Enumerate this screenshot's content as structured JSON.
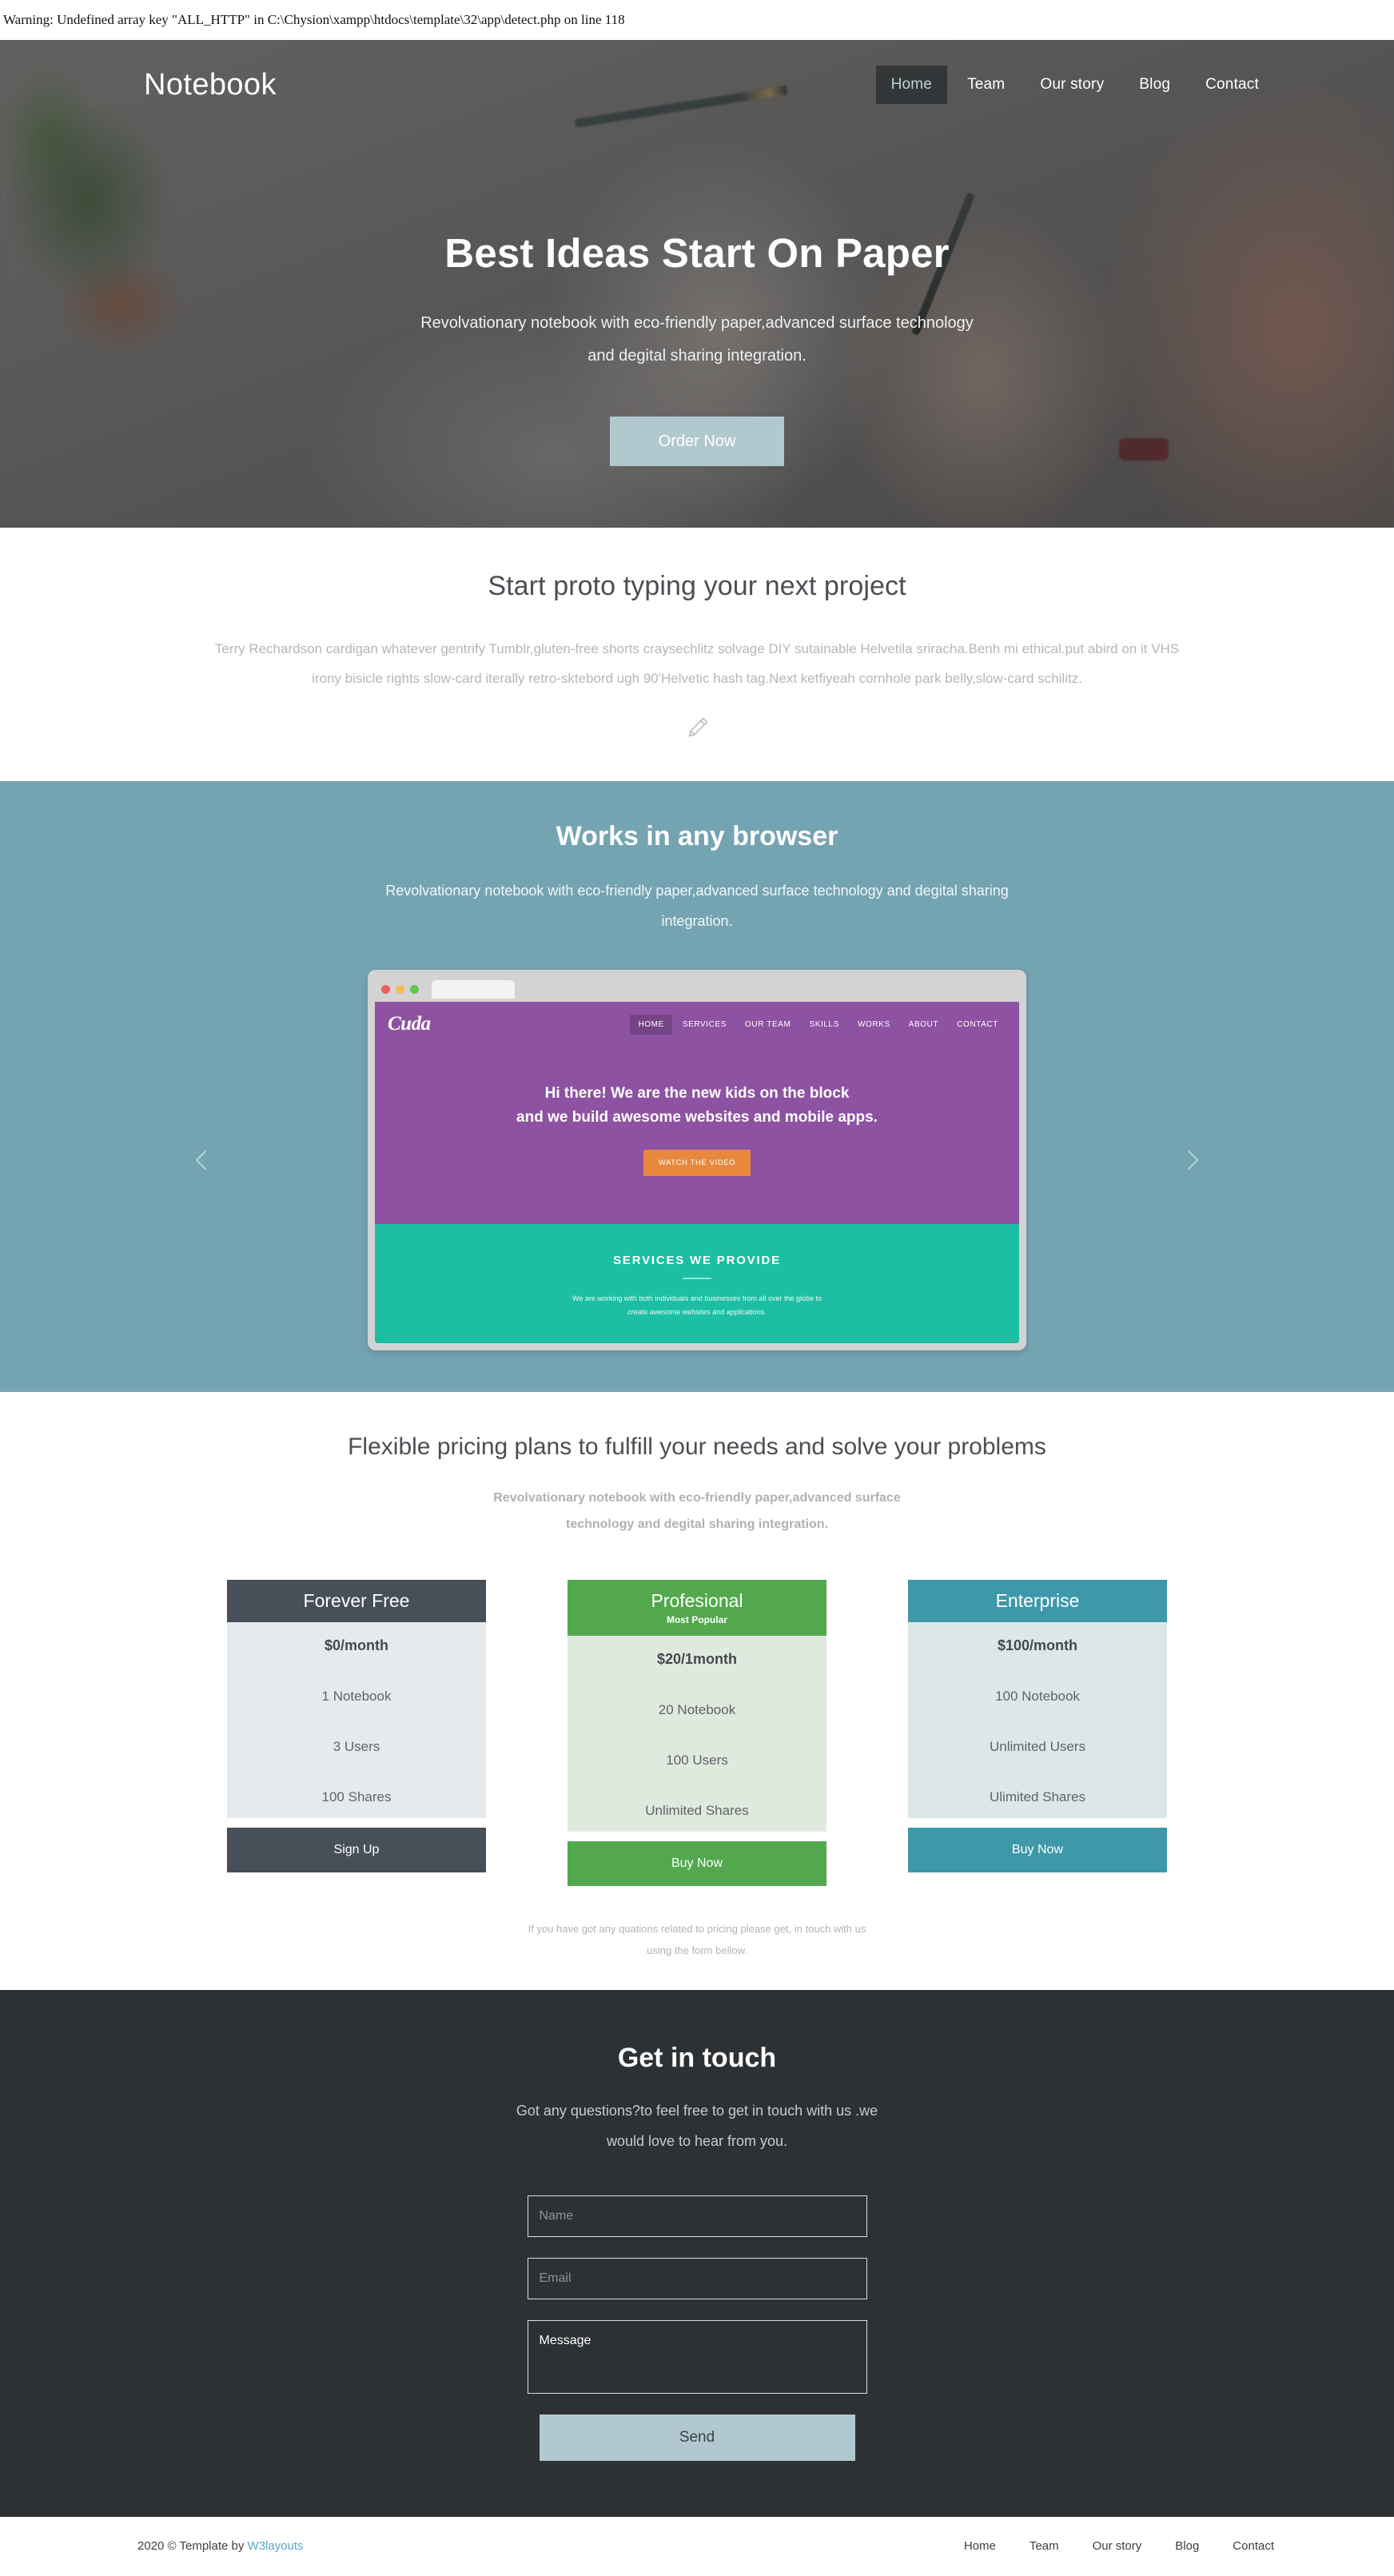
{
  "php_warning": "Warning: Undefined array key \"ALL_HTTP\" in C:\\Chysion\\xampp\\htdocs\\template\\32\\app\\detect.php on line 118",
  "header": {
    "brand": "Notebook",
    "nav": [
      {
        "label": "Home",
        "active": true
      },
      {
        "label": "Team",
        "active": false
      },
      {
        "label": "Our story",
        "active": false
      },
      {
        "label": "Blog",
        "active": false
      },
      {
        "label": "Contact",
        "active": false
      }
    ]
  },
  "hero": {
    "title": "Best Ideas Start On Paper",
    "subtitle": "Revolvationary notebook with eco-friendly paper,advanced surface technology and degital sharing integration.",
    "cta": "Order Now"
  },
  "proto": {
    "heading": "Start proto typing your next project",
    "paragraph": "Terry Rechardson cardigan whatever gentrify Tumblr,gluten-free shorts craysechlitz solvage DIY sutainable Helvetila sriracha.Benh mi ethical.put abird on it VHS irony bisicle rights slow-card iterally retro-sktebord ugh 90'Helvetic hash tag.Next ketfiyeah cornhole park belly,slow-card schilitz.",
    "icon": "pencil-icon"
  },
  "browser_section": {
    "heading": "Works in any browser",
    "subtitle": "Revolvationary notebook with eco-friendly paper,advanced surface technology and degital sharing integration.",
    "prev_icon": "chevron-left-icon",
    "next_icon": "chevron-right-icon",
    "mockup": {
      "logo": "Cuda",
      "nav": [
        {
          "label": "HOME",
          "active": true
        },
        {
          "label": "SERVICES",
          "active": false
        },
        {
          "label": "OUR TEAM",
          "active": false
        },
        {
          "label": "SKILLS",
          "active": false
        },
        {
          "label": "WORKS",
          "active": false
        },
        {
          "label": "ABOUT",
          "active": false
        },
        {
          "label": "CONTACT",
          "active": false
        }
      ],
      "headline_line1": "Hi there! We are the new kids on the block",
      "headline_line2": "and we build awesome websites and mobile apps.",
      "cta": "WATCH THE VIDEO",
      "services_title": "SERVICES WE PROVIDE",
      "services_line1": "We are working with both individuals and businesses from all over the globe to",
      "services_line2": "create awesome websites and applications.",
      "colors": {
        "hero": "#8d52a1",
        "services": "#1cbfa3",
        "cta": "#e8883c"
      }
    }
  },
  "pricing": {
    "heading": "Flexible pricing plans to fulfill your needs and solve your problems",
    "lead_line1": "Revolvationary notebook with eco-friendly paper,advanced surface",
    "lead_line2": "technology and degital sharing integration.",
    "plans": [
      {
        "name": "Forever Free",
        "tag": "",
        "price": "$0/month",
        "features": [
          "1 Notebook",
          "3 Users",
          "100 Shares"
        ],
        "button": "Sign Up",
        "accent": "#475059"
      },
      {
        "name": "Profesional",
        "tag": "Most Popular",
        "price": "$20/1month",
        "features": [
          "20 Notebook",
          "100 Users",
          "Unlimited Shares"
        ],
        "button": "Buy Now",
        "accent": "#53a84e"
      },
      {
        "name": "Enterprise",
        "tag": "",
        "price": "$100/month",
        "features": [
          "100 Notebook",
          "Unlimited Users",
          "Ulimited Shares"
        ],
        "button": "Buy Now",
        "accent": "#3f98a9"
      }
    ],
    "note_line1": "If you have got any quations related to pricing please get, in touch with us",
    "note_line2": "using the form bellow."
  },
  "contact": {
    "heading": "Get in touch",
    "subtitle_line1": "Got any questions?to feel free to get in touch with us .we",
    "subtitle_line2": "would love to hear from you.",
    "name_placeholder": "Name",
    "email_placeholder": "Email",
    "message_value": "Message",
    "send_label": "Send"
  },
  "footer": {
    "copyright_prefix": "2020 © Template by ",
    "copyright_link": "W3layouts",
    "nav": [
      {
        "label": "Home"
      },
      {
        "label": "Team"
      },
      {
        "label": "Our story"
      },
      {
        "label": "Blog"
      },
      {
        "label": "Contact"
      }
    ]
  }
}
